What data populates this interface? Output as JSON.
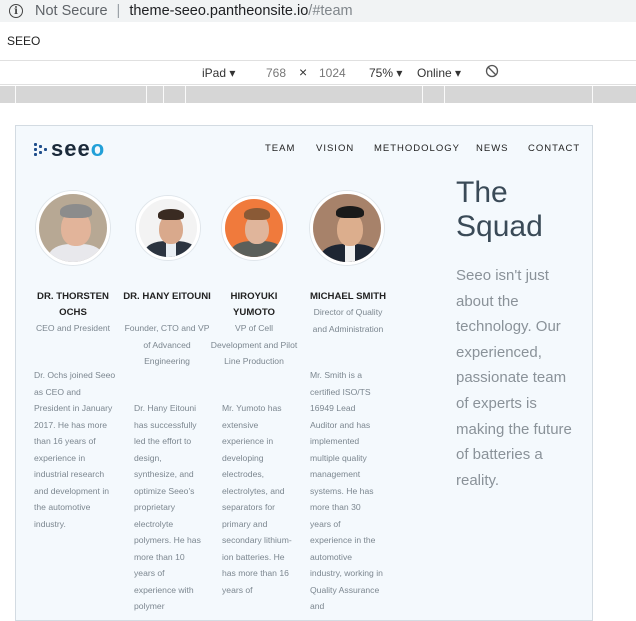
{
  "browser": {
    "security_label": "Not Secure",
    "url_host": "theme-seeo.pantheonsite.io",
    "url_path": "/#team",
    "tab_title": "SEEO",
    "device": "iPad",
    "width": "768",
    "height": "1024",
    "zoom": "75%",
    "network": "Online"
  },
  "site": {
    "logo_text": "seeo",
    "nav": [
      "TEAM",
      "VISION",
      "METHODOLOGY",
      "NEWS",
      "CONTACT"
    ]
  },
  "team": [
    {
      "name": "DR. THORSTEN OCHS",
      "role": "CEO and President",
      "bio": "Dr. Ochs joined Seeo as CEO and President in January 2017. He has more than 16 years of experience in industrial research and development in the automotive industry."
    },
    {
      "name": "DR. HANY EITOUNI",
      "role": "Founder, CTO and VP of Advanced Engineering",
      "bio": "Dr. Hany Eitouni has successfully led the effort to design, synthesize, and optimize Seeo's proprietary electrolyte polymers. He has more than 10 years of experience with polymer"
    },
    {
      "name": "HIROYUKI YUMOTO",
      "role": "VP of Cell Development and Pilot Line Production",
      "bio": "Mr. Yumoto has extensive experience in developing electrodes, electrolytes, and separators for primary and secondary lithium-ion batteries. He has more than 16 years of"
    },
    {
      "name": "MICHAEL SMITH",
      "role": "Director of Quality and Administration",
      "bio": "Mr. Smith is a certified ISO/TS 16949 Lead Auditor and has implemented multiple quality management systems. He has more than 30 years of experience in the automotive industry, working in Quality Assurance and"
    }
  ],
  "squad": {
    "title_line1": "The",
    "title_line2": "Squad",
    "body": "Seeo isn't just about the technology. Our experienced, passionate team of experts is making the future of batteries a reality."
  }
}
